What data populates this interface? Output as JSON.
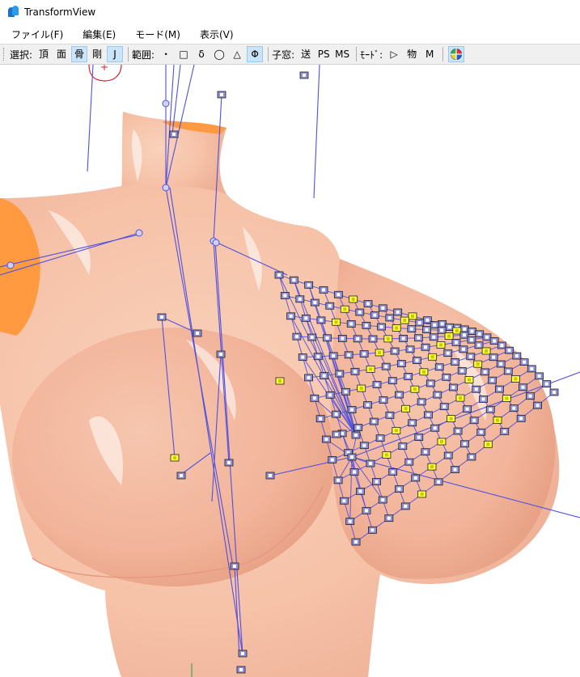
{
  "window": {
    "title": "TransformView"
  },
  "menu": [
    {
      "label": "ファイル(F)"
    },
    {
      "label": "編集(E)"
    },
    {
      "label": "モード(M)"
    },
    {
      "label": "表示(V)"
    }
  ],
  "toolbar": {
    "select_label": "選択:",
    "select_buttons": [
      "頂",
      "面",
      "骨",
      "剛",
      "J"
    ],
    "range_label": "範囲:",
    "range_buttons": [
      "・",
      "□",
      "δ",
      "◯",
      "△",
      "Φ"
    ],
    "child_label": "子窓:",
    "child_buttons": [
      "送",
      "PS",
      "MS"
    ],
    "mode_label": "ﾓｰﾄﾞ:",
    "mode_buttons": [
      "▷",
      "物",
      "M"
    ],
    "target_icon": "target-icon"
  },
  "colors": {
    "skin": "#f8c8b0",
    "skin_shadow": "#f0a890",
    "orange": "#ff9a40",
    "bone_line": "#5050e0",
    "bone_box_fill": "#9090d8",
    "bone_marker": "#ffff40",
    "pivot_red": "#d02030"
  }
}
